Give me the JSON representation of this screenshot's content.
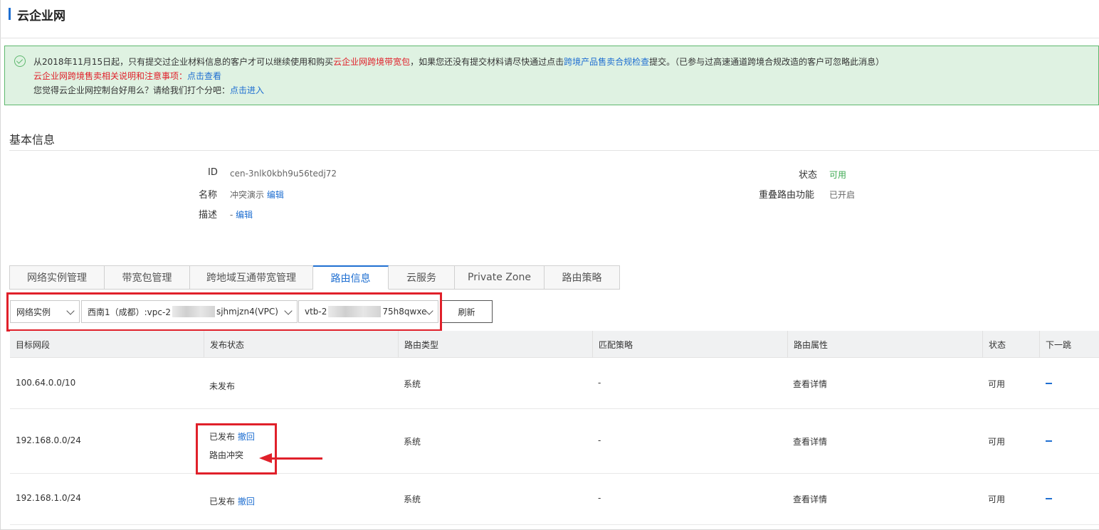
{
  "header": {
    "title": "云企业网"
  },
  "notice": {
    "line1_a": "从2018年11月15日起，只有提交过企业材料信息的客户才可以继续使用和购买",
    "line1_red": "云企业网跨境带宽包",
    "line1_b": "，如果您还没有提交材料请尽快通过点击",
    "line1_link": "跨境产品售卖合规检查",
    "line1_c": "提交。（已参与过高速通道跨境合规改造的客户可忽略此消息）",
    "line2_red": "云企业网跨境售卖相关说明和注意事项：",
    "line2_link": "点击查看",
    "line3_text": "您觉得云企业网控制台好用么？请给我们打个分吧：",
    "line3_link": "点击进入"
  },
  "basic_info": {
    "title": "基本信息",
    "id_label": "ID",
    "id_value": "cen-3nlk0kbh9u56tedj72",
    "name_label": "名称",
    "name_value": "冲突演示",
    "edit": "编辑",
    "desc_label": "描述",
    "desc_value": "-",
    "status_label": "状态",
    "status_value": "可用",
    "overlap_label": "重叠路由功能",
    "overlap_value": "已开启"
  },
  "tabs": [
    "网络实例管理",
    "带宽包管理",
    "跨地域互通带宽管理",
    "路由信息",
    "云服务",
    "Private Zone",
    "路由策略"
  ],
  "active_tab": "路由信息",
  "filters": {
    "instance_type": "网络实例",
    "vpc_prefix": "西南1（成都）:vpc-2",
    "vpc_suffix": "sjhmjzn4(VPC)",
    "vtb_prefix": "vtb-2",
    "vtb_suffix": "75h8qwxe",
    "refresh": "刷新"
  },
  "table": {
    "columns": [
      "目标网段",
      "发布状态",
      "路由类型",
      "匹配策略",
      "路由属性",
      "状态",
      "下一跳"
    ],
    "rows": [
      {
        "cidr": "100.64.0.0/10",
        "publish": "未发布",
        "action": "",
        "conflict": "",
        "type": "系统",
        "policy": "-",
        "attr": "查看详情",
        "status": "可用"
      },
      {
        "cidr": "192.168.0.0/24",
        "publish": "已发布",
        "action": "撤回",
        "conflict": "路由冲突",
        "type": "系统",
        "policy": "-",
        "attr": "查看详情",
        "status": "可用"
      },
      {
        "cidr": "192.168.1.0/24",
        "publish": "已发布",
        "action": "撤回",
        "conflict": "",
        "type": "系统",
        "policy": "-",
        "attr": "查看详情",
        "status": "可用"
      }
    ]
  },
  "colors": {
    "accent": "#1f6fd1",
    "highlight": "#e0202a",
    "success": "#3eaa52"
  }
}
